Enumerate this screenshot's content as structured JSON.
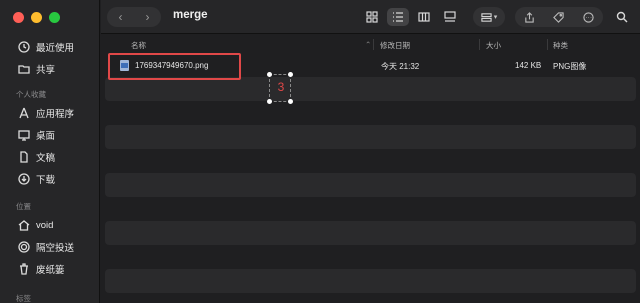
{
  "window": {
    "title": "merge"
  },
  "sidebar": {
    "favorites": [
      {
        "label": "最近使用",
        "icon": "clock-icon"
      },
      {
        "label": "共享",
        "icon": "shared-folder-icon"
      }
    ],
    "personal_header": "个人收藏",
    "personal": [
      {
        "label": "应用程序",
        "icon": "applications-icon"
      },
      {
        "label": "桌面",
        "icon": "desktop-icon"
      },
      {
        "label": "文稿",
        "icon": "document-icon"
      },
      {
        "label": "下载",
        "icon": "download-icon"
      }
    ],
    "locations_header": "位置",
    "locations": [
      {
        "label": "void",
        "icon": "home-icon"
      },
      {
        "label": "隔空投送",
        "icon": "airdrop-icon"
      },
      {
        "label": "废纸篓",
        "icon": "trash-icon"
      }
    ],
    "tags_header": "标签"
  },
  "columns": {
    "name": "名称",
    "modified": "修改日期",
    "size": "大小",
    "kind": "种类"
  },
  "files": [
    {
      "name": "1769347949670.png",
      "modified": "今天 21:32",
      "size": "142 KB",
      "kind": "PNG图像"
    }
  ],
  "annotation": {
    "label": "3"
  },
  "colors": {
    "accent_red": "#e04848",
    "window_bg": "#1f1f21"
  }
}
